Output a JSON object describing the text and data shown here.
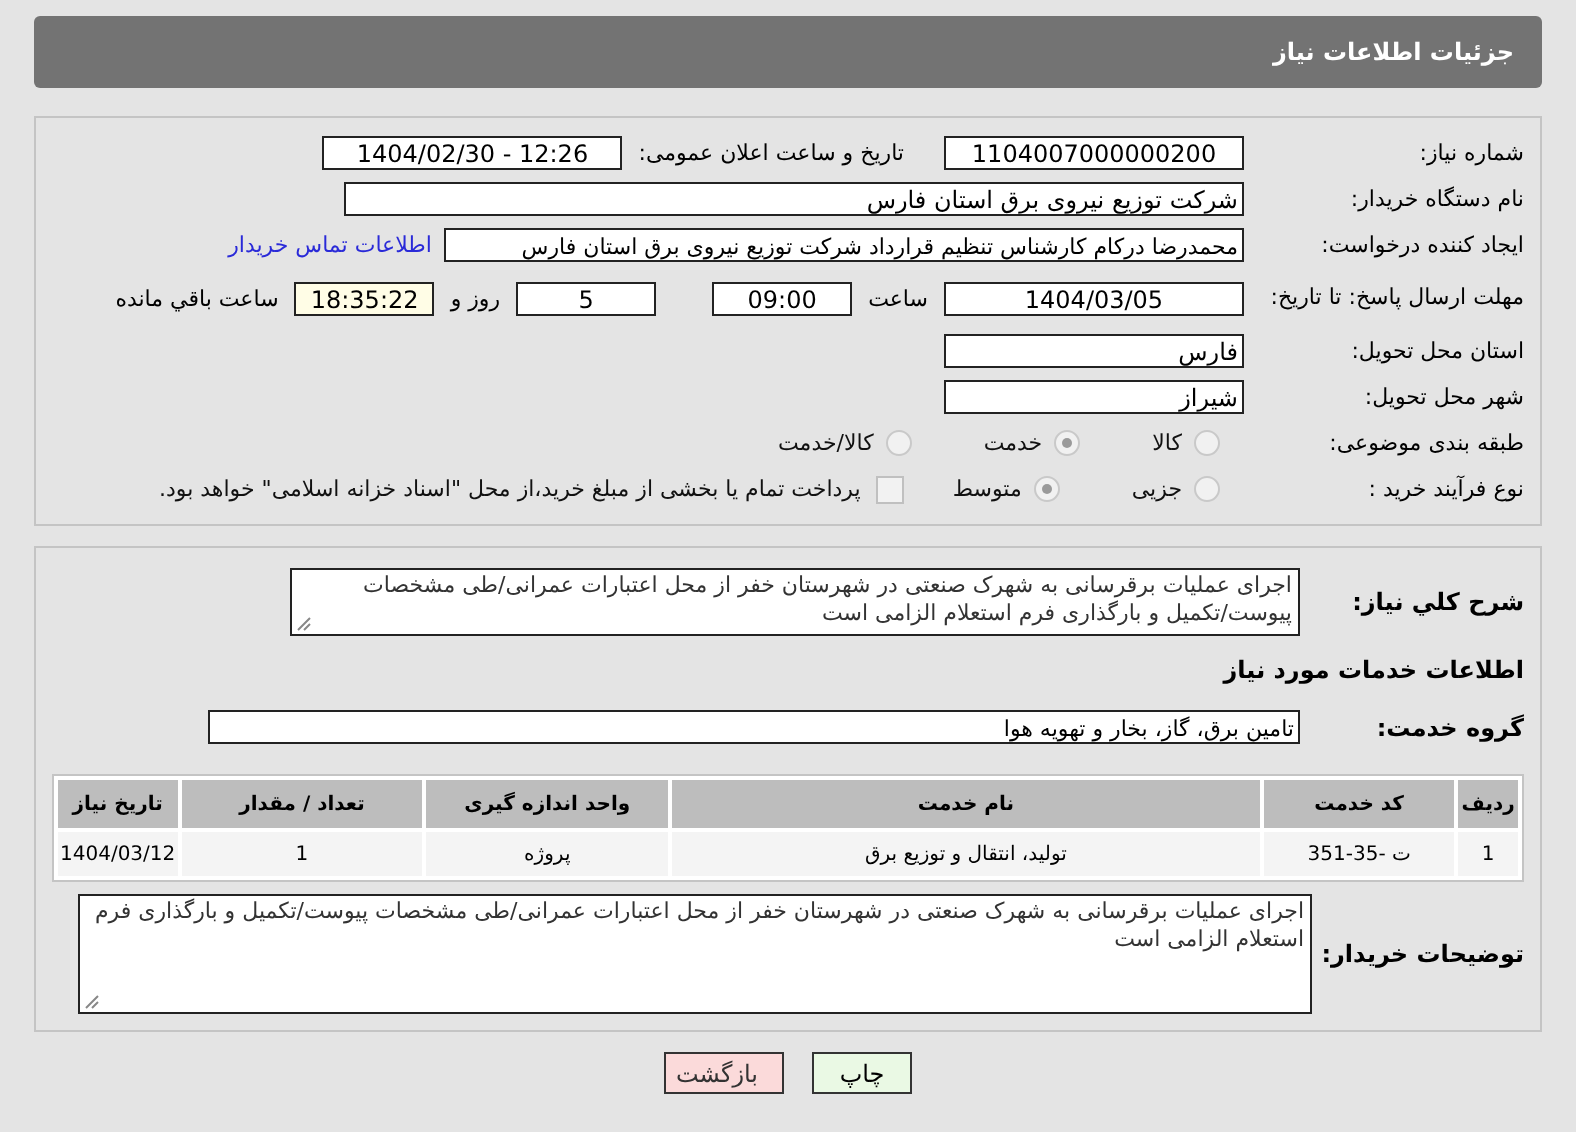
{
  "header": {
    "title": "جزئیات اطلاعات نیاز"
  },
  "details": {
    "need_number": {
      "label": "شماره نیاز:",
      "value": "1104007000000200"
    },
    "announce": {
      "label": "تاریخ و ساعت اعلان عمومی:",
      "value": "1404/02/30 - 12:26"
    },
    "buyer": {
      "label": "نام دستگاه خریدار:",
      "value": "شرکت توزیع نیروی برق استان فارس"
    },
    "creator": {
      "label": "ایجاد کننده درخواست:",
      "value": "محمدرضا درکام کارشناس تنظیم قرارداد شرکت توزیع نیروی برق استان فارس",
      "link": "اطلاعات تماس خریدار"
    },
    "deadline": {
      "label": "مهلت ارسال پاسخ: تا تاریخ:",
      "date": "1404/03/05",
      "time_label": "ساعت",
      "time": "09:00",
      "days": "5",
      "days_label": "روز و",
      "remaining": "18:35:22",
      "remaining_label": "ساعت باقي مانده"
    },
    "province": {
      "label": "استان محل تحویل:",
      "value": "فارس"
    },
    "city": {
      "label": "شهر محل تحویل:",
      "value": "شیراز"
    },
    "category": {
      "label": "طبقه بندی موضوعی:",
      "options": [
        {
          "label": "کالا",
          "selected": false
        },
        {
          "label": "خدمت",
          "selected": true
        },
        {
          "label": "کالا/خدمت",
          "selected": false
        }
      ]
    },
    "purchase_type": {
      "label": "نوع فرآیند خرید :",
      "options": [
        {
          "label": "جزیی",
          "selected": false
        },
        {
          "label": "متوسط",
          "selected": true
        }
      ],
      "treasury": {
        "checked": false,
        "label": "پرداخت تمام یا بخشی از مبلغ خرید،از محل \"اسناد خزانه اسلامی\" خواهد بود."
      }
    }
  },
  "needs": {
    "description": {
      "label": "شرح کلي نياز:",
      "value": "اجرای عملیات برقرسانی به شهرک صنعتی در شهرستان خفر از محل اعتبارات عمرانی/طی مشخصات پیوست/تکمیل و بارگذاری فرم استعلام الزامی است"
    },
    "section_title": "اطلاعات خدمات مورد نیاز",
    "service_group": {
      "label": "گروه خدمت:",
      "value": "تامین برق، گاز، بخار و تهویه هوا"
    },
    "table": {
      "columns": [
        "ردیف",
        "کد خدمت",
        "نام خدمت",
        "واحد اندازه گیری",
        "تعداد / مقدار",
        "تاریخ نیاز"
      ],
      "rows": [
        [
          "1",
          "ت -35-351",
          "تولید، انتقال و توزیع برق",
          "پروژه",
          "1",
          "1404/03/12"
        ]
      ]
    },
    "buyer_notes": {
      "label": "توضیحات خریدار:",
      "value": "اجرای عملیات برقرسانی به شهرک صنعتی در شهرستان خفر از محل اعتبارات عمرانی/طی مشخصات پیوست/تکمیل و بارگذاری فرم استعلام الزامی است"
    }
  },
  "buttons": [
    {
      "label": "چاپ",
      "kind": "print"
    },
    {
      "label": "بازگشت",
      "kind": "back"
    }
  ]
}
